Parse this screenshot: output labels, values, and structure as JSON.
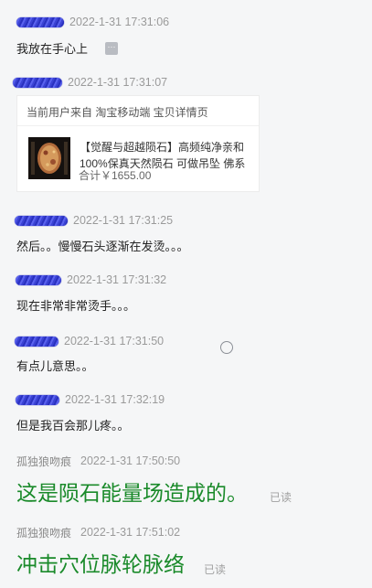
{
  "messages": [
    {
      "time": "2022-1-31 17:31:06",
      "text": "我放在手心上"
    },
    {
      "time": "2022-1-31 17:31:07",
      "card": {
        "source": "当前用户来自 淘宝移动端 宝贝详情页",
        "title_line1": "【觉醒与超越陨石】高频纯净亲和",
        "title_line2": "100%保真天然陨石 可做吊坠 佛系",
        "total": "合计￥1655.00"
      }
    },
    {
      "time": "2022-1-31 17:31:25",
      "text": "然后。。慢慢石头逐渐在发烫。。。"
    },
    {
      "time": "2022-1-31 17:31:32",
      "text": "现在非常非常烫手。。。"
    },
    {
      "time": "2022-1-31 17:31:50",
      "text": "有点儿意思。。"
    },
    {
      "time": "2022-1-31 17:32:19",
      "text": "但是我百会那儿疼。。"
    },
    {
      "sender": "孤独狼吻痕",
      "time": "2022-1-31 17:50:50",
      "text": "这是陨石能量场造成的。",
      "status": "已读"
    },
    {
      "sender": "孤独狼吻痕",
      "time": "2022-1-31 17:51:02",
      "text": "冲击穴位脉轮脉络",
      "status": "已读"
    }
  ],
  "more_icon": "ellipsis-icon",
  "colors": {
    "redaction": "#3b43d4",
    "seller_text": "#1a8a2a",
    "time": "#9a9a9a",
    "background": "#f5f6f7"
  }
}
